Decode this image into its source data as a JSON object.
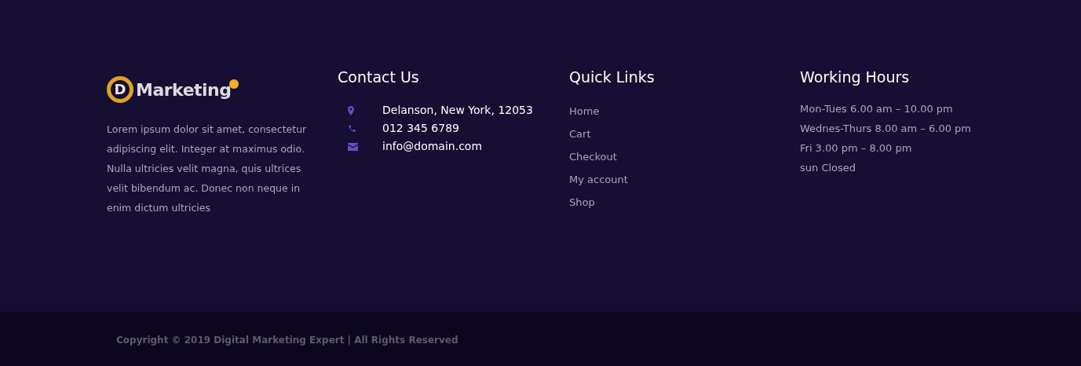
{
  "brand": {
    "logo_letter": "D",
    "logo_text": "Marketing"
  },
  "about": "Lorem ipsum dolor sit amet, consectetur adipiscing elit. Integer at maximus odio. Nulla ultricies velit magna, quis ultrices velit bibendum ac. Donec non neque in enim dictum ultricies",
  "contact": {
    "title": "Contact Us",
    "items": [
      {
        "kind": "location",
        "text": "Delanson, New York, 12053"
      },
      {
        "kind": "phone",
        "text": "012 345 6789"
      },
      {
        "kind": "email",
        "text": "info@domain.com"
      }
    ]
  },
  "quick_links": {
    "title": "Quick Links",
    "items": [
      "Home",
      "Cart",
      "Checkout",
      "My account",
      "Shop"
    ]
  },
  "working_hours": {
    "title": "Working Hours",
    "items": [
      "Mon-Tues 6.00 am – 10.00 pm",
      "Wednes-Thurs 8.00 am – 6.00 pm",
      "Fri 3.00 pm – 8.00 pm",
      "sun Closed"
    ]
  },
  "copyright": "Copyright © 2019 Digital Marketing Expert | All Rights Reserved"
}
